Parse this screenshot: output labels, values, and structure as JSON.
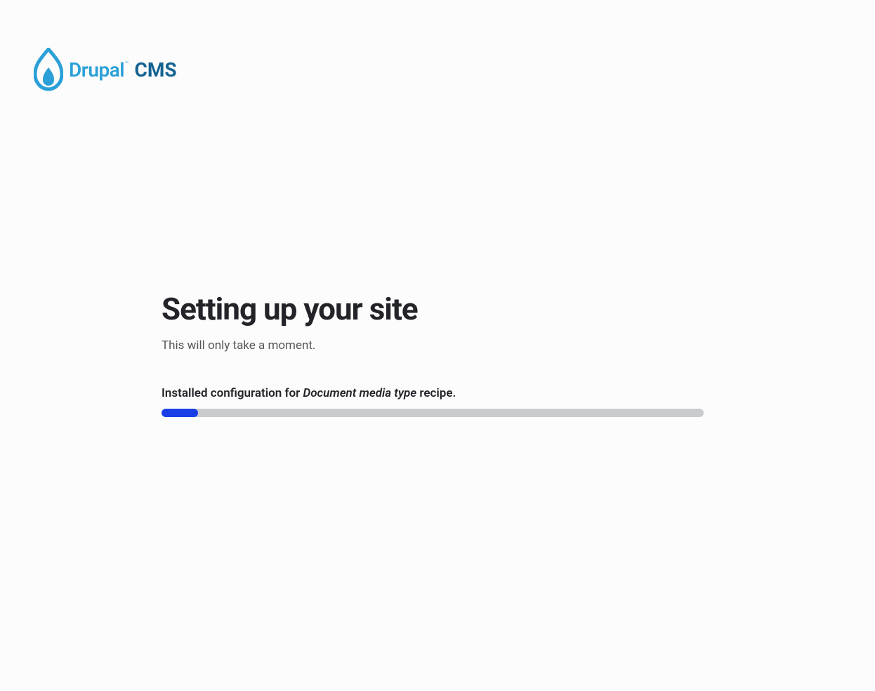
{
  "logo": {
    "brand": "Drupal",
    "tm": "™",
    "suffix": "CMS"
  },
  "main": {
    "title": "Setting up your site",
    "subtitle": "This will only take a moment.",
    "status_prefix": "Installed configuration for ",
    "status_italic": "Document media type",
    "status_suffix": " recipe.",
    "progress_percent": 6.7
  }
}
